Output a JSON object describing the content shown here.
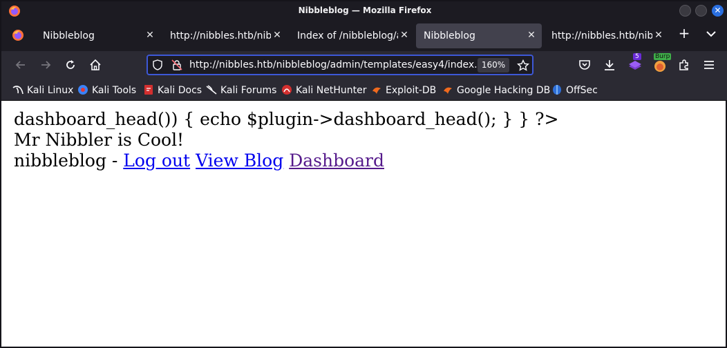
{
  "window": {
    "title": "Nibbleblog — Mozilla Firefox"
  },
  "tabs": [
    {
      "label": "Nibbleblog",
      "active": false
    },
    {
      "label": "http://nibbles.htb/nibb",
      "active": false
    },
    {
      "label": "Index of /nibbleblog/ad",
      "active": false
    },
    {
      "label": "Nibbleblog",
      "active": true
    },
    {
      "label": "http://nibbles.htb/nibb",
      "active": false
    }
  ],
  "navbar": {
    "url": "http://nibbles.htb/nibbleblog/admin/templates/easy4/index.",
    "zoom": "160%",
    "extension_badge": "5",
    "burp_label": "Burp"
  },
  "bookmarks": [
    {
      "label": "Kali Linux",
      "icon": "kali-icon"
    },
    {
      "label": "Kali Tools",
      "icon": "kali-tools-icon"
    },
    {
      "label": "Kali Docs",
      "icon": "kali-docs-icon"
    },
    {
      "label": "Kali Forums",
      "icon": "kali-forums-icon"
    },
    {
      "label": "Kali NetHunter",
      "icon": "nethunter-icon"
    },
    {
      "label": "Exploit-DB",
      "icon": "exploitdb-icon"
    },
    {
      "label": "Google Hacking DB",
      "icon": "ghdb-icon"
    },
    {
      "label": "OffSec",
      "icon": "offsec-icon"
    }
  ],
  "page": {
    "line1": "dashboard_head()) { echo $plugin->dashboard_head(); } } ?>",
    "line2": "Mr Nibbler is Cool!",
    "line3_prefix": "nibbleblog - ",
    "logout_link": "Log out",
    "view_blog_link": "View Blog",
    "dashboard_link": "Dashboard"
  },
  "colors": {
    "link": "#0000ee",
    "visited_link": "#551a8b",
    "url_focus": "#3d58d8"
  }
}
